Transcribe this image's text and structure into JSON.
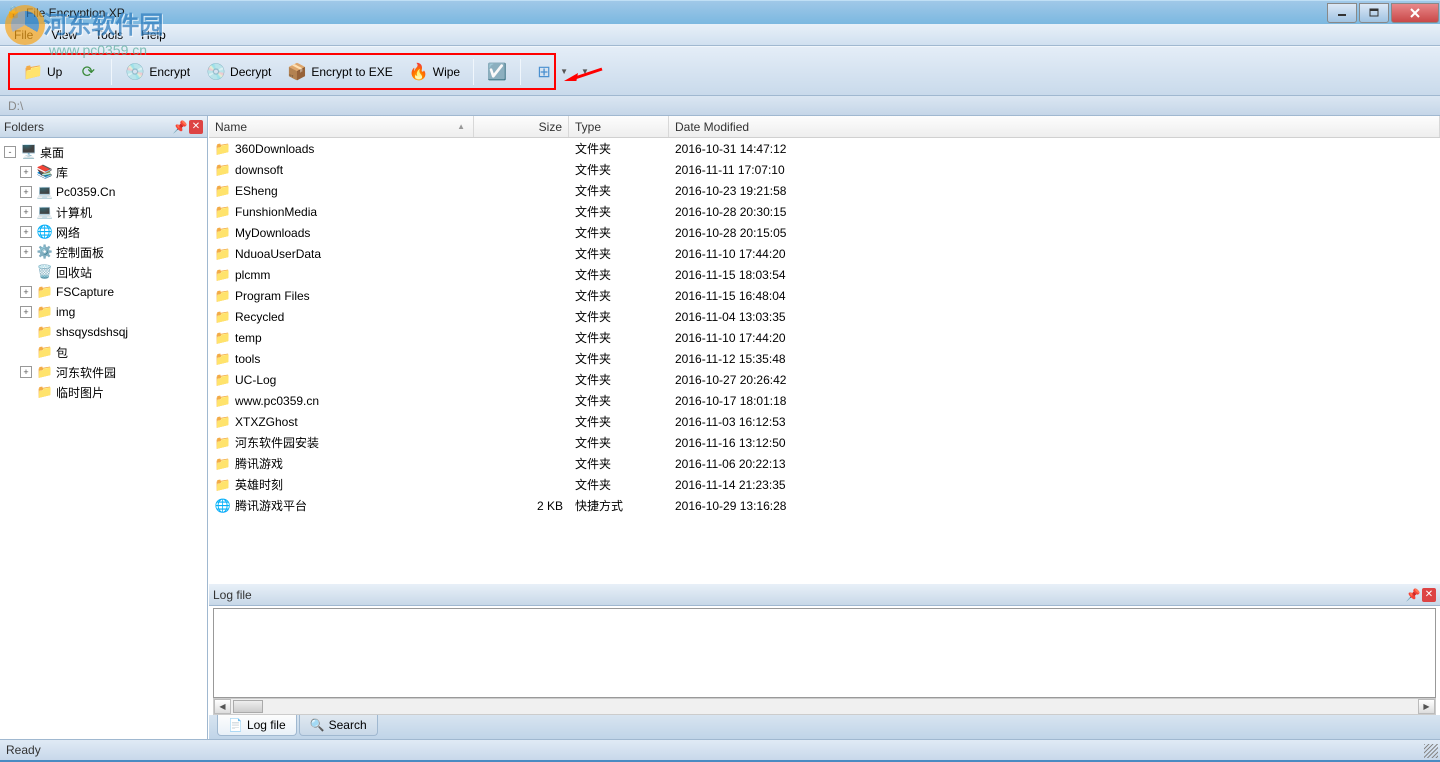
{
  "title": "File Encryption XP",
  "watermark": {
    "text": "河东软件园",
    "url": "www.pc0359.cn"
  },
  "menus": [
    "File",
    "View",
    "Tools",
    "Help"
  ],
  "toolbar": {
    "up": "Up",
    "encrypt": "Encrypt",
    "decrypt": "Decrypt",
    "encrypt_exe": "Encrypt to EXE",
    "wipe": "Wipe"
  },
  "path": "D:\\",
  "folders_panel": {
    "title": "Folders"
  },
  "tree": [
    {
      "d": 0,
      "tw": "-",
      "icon": "🖥️",
      "label": "桌面"
    },
    {
      "d": 1,
      "tw": "+",
      "icon": "📚",
      "label": "库"
    },
    {
      "d": 1,
      "tw": "+",
      "icon": "💻",
      "label": "Pc0359.Cn"
    },
    {
      "d": 1,
      "tw": "+",
      "icon": "💻",
      "label": "计算机"
    },
    {
      "d": 1,
      "tw": "+",
      "icon": "🌐",
      "label": "网络"
    },
    {
      "d": 1,
      "tw": "+",
      "icon": "⚙️",
      "label": "控制面板"
    },
    {
      "d": 1,
      "tw": "b",
      "icon": "🗑️",
      "label": "回收站"
    },
    {
      "d": 1,
      "tw": "+",
      "icon": "📁",
      "label": "FSCapture"
    },
    {
      "d": 1,
      "tw": "+",
      "icon": "📁",
      "label": "img"
    },
    {
      "d": 1,
      "tw": "b",
      "icon": "📁",
      "label": "shsqysdshsqj"
    },
    {
      "d": 1,
      "tw": "b",
      "icon": "📁",
      "label": "包"
    },
    {
      "d": 1,
      "tw": "+",
      "icon": "📁",
      "label": "河东软件园"
    },
    {
      "d": 1,
      "tw": "b",
      "icon": "📁",
      "label": "临时图片"
    }
  ],
  "columns": {
    "name": "Name",
    "size": "Size",
    "type": "Type",
    "date": "Date Modified"
  },
  "files": [
    {
      "icon": "📁",
      "name": "360Downloads",
      "size": "",
      "type": "文件夹",
      "date": "2016-10-31 14:47:12"
    },
    {
      "icon": "📁",
      "name": "downsoft",
      "size": "",
      "type": "文件夹",
      "date": "2016-11-11 17:07:10"
    },
    {
      "icon": "📁",
      "name": "ESheng",
      "size": "",
      "type": "文件夹",
      "date": "2016-10-23 19:21:58"
    },
    {
      "icon": "📁",
      "name": "FunshionMedia",
      "size": "",
      "type": "文件夹",
      "date": "2016-10-28 20:30:15"
    },
    {
      "icon": "📁",
      "name": "MyDownloads",
      "size": "",
      "type": "文件夹",
      "date": "2016-10-28 20:15:05"
    },
    {
      "icon": "📁",
      "name": "NduoaUserData",
      "size": "",
      "type": "文件夹",
      "date": "2016-11-10 17:44:20"
    },
    {
      "icon": "📁",
      "name": "plcmm",
      "size": "",
      "type": "文件夹",
      "date": "2016-11-15 18:03:54"
    },
    {
      "icon": "📁",
      "name": "Program Files",
      "size": "",
      "type": "文件夹",
      "date": "2016-11-15 16:48:04"
    },
    {
      "icon": "📁",
      "name": "Recycled",
      "size": "",
      "type": "文件夹",
      "date": "2016-11-04 13:03:35"
    },
    {
      "icon": "📁",
      "name": "temp",
      "size": "",
      "type": "文件夹",
      "date": "2016-11-10 17:44:20"
    },
    {
      "icon": "📁",
      "name": "tools",
      "size": "",
      "type": "文件夹",
      "date": "2016-11-12 15:35:48"
    },
    {
      "icon": "📁",
      "name": "UC-Log",
      "size": "",
      "type": "文件夹",
      "date": "2016-10-27 20:26:42"
    },
    {
      "icon": "📁",
      "name": "www.pc0359.cn",
      "size": "",
      "type": "文件夹",
      "date": "2016-10-17 18:01:18"
    },
    {
      "icon": "📁",
      "name": "XTXZGhost",
      "size": "",
      "type": "文件夹",
      "date": "2016-11-03 16:12:53"
    },
    {
      "icon": "📁",
      "name": "河东软件园安装",
      "size": "",
      "type": "文件夹",
      "date": "2016-11-16 13:12:50"
    },
    {
      "icon": "📁",
      "name": "腾讯游戏",
      "size": "",
      "type": "文件夹",
      "date": "2016-11-06 20:22:13"
    },
    {
      "icon": "📁",
      "name": "英雄时刻",
      "size": "",
      "type": "文件夹",
      "date": "2016-11-14 21:23:35"
    },
    {
      "icon": "🌐",
      "name": "腾讯游戏平台",
      "size": "2 KB",
      "type": "快捷方式",
      "date": "2016-10-29 13:16:28"
    }
  ],
  "log_panel": {
    "title": "Log file"
  },
  "bottom_tabs": {
    "log": "Log file",
    "search": "Search"
  },
  "status": "Ready"
}
